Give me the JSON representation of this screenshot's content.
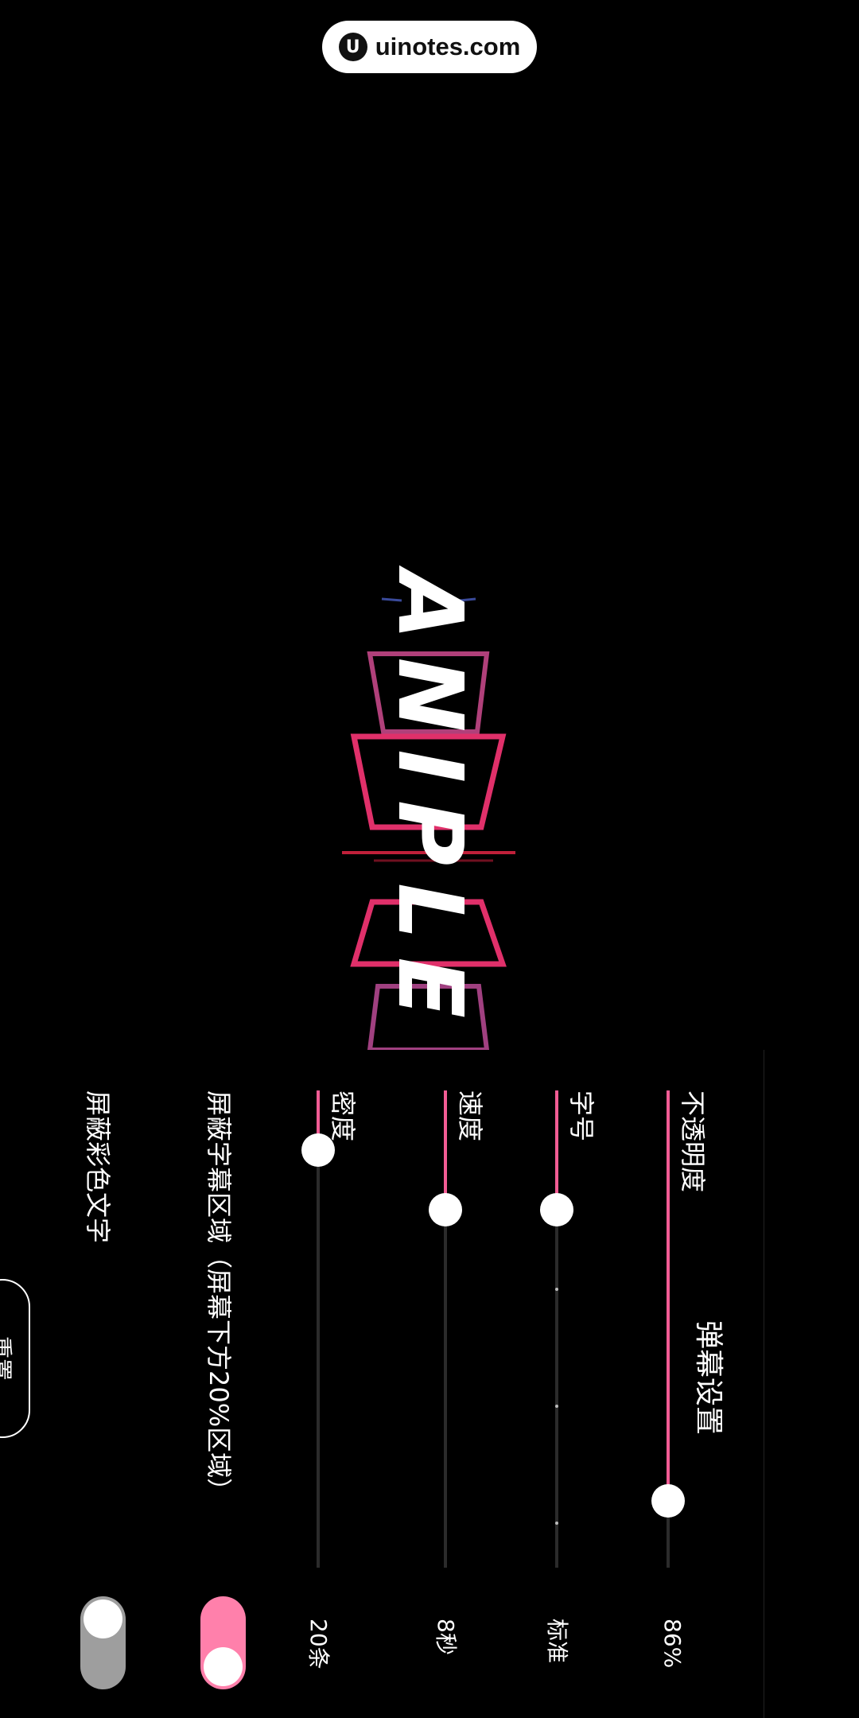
{
  "watermark": {
    "text": "uinotes.com"
  },
  "video": {
    "title_text": "ANIPLE"
  },
  "panel": {
    "title": "弹幕设置",
    "reset_label": "重置",
    "rows": [
      {
        "label": "不透明度",
        "value": "86%",
        "level": 0.86
      },
      {
        "label": "字号",
        "value": "标准",
        "level": 0.25
      },
      {
        "label": "速度",
        "value": "8秒",
        "level": 0.25
      },
      {
        "label": "密度",
        "value": "20条",
        "level": 0.125
      }
    ],
    "toggles": [
      {
        "label": "屏蔽字幕区域（屏幕下方20%区域）",
        "on": true
      },
      {
        "label": "屏蔽彩色文字",
        "on": false
      }
    ]
  },
  "colors": {
    "accent": "#f25c94",
    "toggle_on": "#ff80ab",
    "toggle_off": "#9e9e9e"
  }
}
